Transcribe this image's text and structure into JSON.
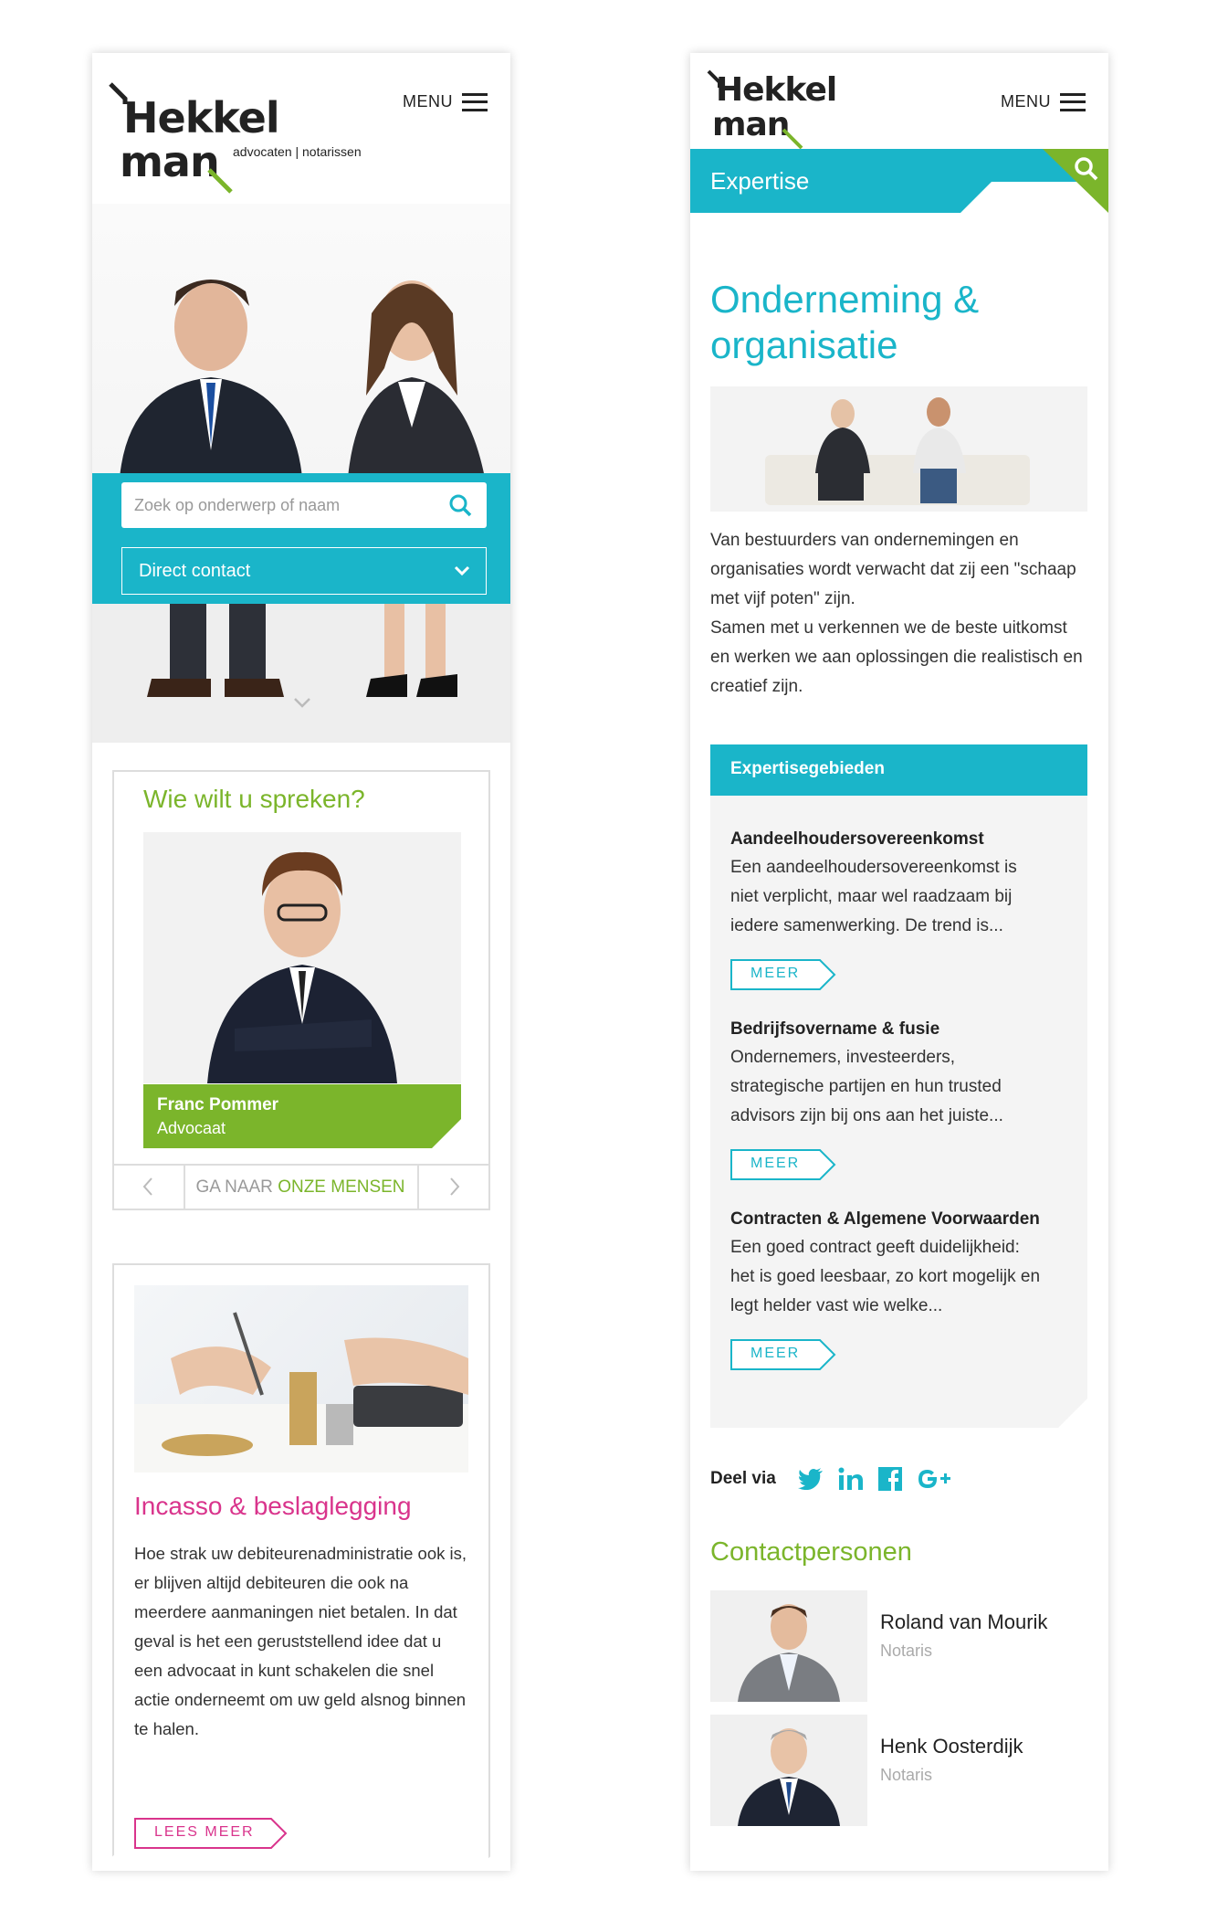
{
  "left": {
    "logo": {
      "line1": "Hekkel",
      "line2": "man",
      "tagline": "advocaten | notarissen"
    },
    "menu_label": "MENU",
    "search": {
      "placeholder": "Zoek op onderwerp of naam"
    },
    "direct_contact": "Direct contact",
    "speak": {
      "title": "Wie wilt u spreken?",
      "person_name": "Franc Pommer",
      "person_role": "Advocaat",
      "nav_prefix": "GA NAAR ",
      "nav_link": "ONZE MENSEN"
    },
    "article": {
      "title": "Incasso & beslaglegging",
      "body": "Hoe strak uw debiteurenadministratie ook is, er blijven altijd debiteuren die ook na meerdere aanmaningen niet betalen. In dat geval is het een geruststellend idee dat u een advocaat in kunt schakelen die snel actie onderneemt om uw geld alsnog binnen te halen.",
      "button": "LEES MEER"
    }
  },
  "right": {
    "logo": {
      "line1": "Hekkel",
      "line2": "man"
    },
    "menu_label": "MENU",
    "section_label": "Expertise",
    "page_title_line1": "Onderneming &",
    "page_title_line2": "organisatie",
    "intro_p1": "Van bestuurders van ondernemingen en organisaties wordt verwacht dat zij een \"schaap met vijf poten\" zijn.",
    "intro_p2": "Samen met u verkennen we de beste uitkomst en werken we aan oplossingen die realistisch en creatief zijn.",
    "expertise_header": "Expertisegebieden",
    "expertise": [
      {
        "title": "Aandeelhoudersovereenkomst",
        "text": "Een aandeelhoudersovereenkomst is niet verplicht, maar wel raadzaam bij iedere samenwerking. De trend is...",
        "button": "MEER"
      },
      {
        "title": "Bedrijfsovername & fusie",
        "text": "Ondernemers, investeerders, strategische partijen en hun trusted advisors zijn bij ons aan het juiste...",
        "button": "MEER"
      },
      {
        "title": "Contracten & Algemene Voorwaarden",
        "text": "Een goed contract geeft duidelijkheid: het is goed leesbaar, zo kort mogelijk en legt helder vast wie welke...",
        "button": "MEER"
      }
    ],
    "share_label": "Deel via",
    "contacts_title": "Contactpersonen",
    "contacts": [
      {
        "name": "Roland van Mourik",
        "role": "Notaris"
      },
      {
        "name": "Henk Oosterdijk",
        "role": "Notaris"
      }
    ]
  },
  "colors": {
    "teal": "#1ab5c9",
    "green": "#7bb52b",
    "pink": "#d9348c",
    "dark": "#222222"
  },
  "icons": [
    "hamburger-icon",
    "search-icon",
    "chevron-down-icon",
    "chevron-left-icon",
    "chevron-right-icon",
    "twitter-icon",
    "linkedin-icon",
    "facebook-icon",
    "google-plus-icon"
  ]
}
